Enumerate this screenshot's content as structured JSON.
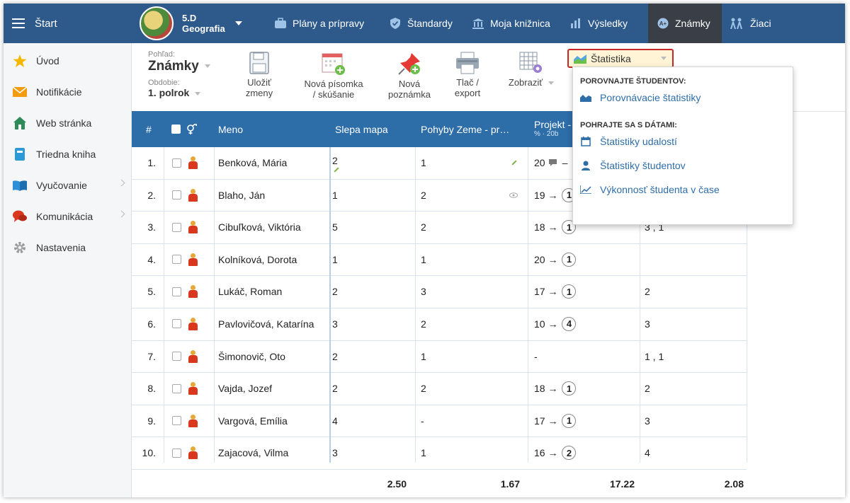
{
  "topbar": {
    "start_label": "Štart",
    "class_name": "5.D",
    "subject": "Geografia",
    "nav": [
      {
        "label": "Plány a prípravy",
        "icon": "briefcase-icon"
      },
      {
        "label": "Štandardy",
        "icon": "shield-check-icon"
      },
      {
        "label": "Moja knižnica",
        "icon": "library-icon"
      },
      {
        "label": "Výsledky",
        "icon": "bar-chart-icon"
      },
      {
        "label": "Známky",
        "icon": "grade-badge-icon"
      },
      {
        "label": "Žiaci",
        "icon": "students-icon"
      }
    ]
  },
  "sidebar": {
    "items": [
      {
        "label": "Úvod",
        "icon": "star-icon"
      },
      {
        "label": "Notifikácie",
        "icon": "envelope-icon"
      },
      {
        "label": "Web stránka",
        "icon": "home-icon"
      },
      {
        "label": "Triedna kniha",
        "icon": "book-icon"
      },
      {
        "label": "Vyučovanie",
        "icon": "open-book-icon"
      },
      {
        "label": "Komunikácia",
        "icon": "chat-icon"
      },
      {
        "label": "Nastavenia",
        "icon": "gear-icon"
      }
    ]
  },
  "toolbar": {
    "view_label": "Pohľad:",
    "view_value": "Známky",
    "period_label": "Obdobie:",
    "period_value": "1. polrok",
    "save_l1": "Uložiť",
    "save_l2": "zmeny",
    "new_test_l1": "Nová písomka",
    "new_test_l2": "/ skúšanie",
    "new_note_l1": "Nová",
    "new_note_l2": "poznámka",
    "print_l1": "Tlač /",
    "print_l2": "export",
    "show_label": "Zobraziť",
    "stats_label": "Štatistika"
  },
  "dropdown": {
    "compare_heading": "POROVNAJTE ŠTUDENTOV:",
    "compare_item": "Porovnávacie štatistiky",
    "play_heading": "POHRAJTE SA S DÁTAMI:",
    "event_stats": "Štatistiky udalostí",
    "student_stats": "Štatistiky študentov",
    "performance": "Výkonnosť študenta v čase"
  },
  "table": {
    "headers": {
      "num": "#",
      "gender_icon": "gender-icon",
      "name": "Meno",
      "col1": "Slepa mapa",
      "col2": "Pohyby Zeme - pr…",
      "col3": "Projekt -",
      "col3_sub": "% · 20b"
    },
    "rows": [
      {
        "num": "1.",
        "name": "Benková, Mária",
        "c1": "2",
        "c2": "1",
        "c3": "20",
        "c3grade": "",
        "c4": ""
      },
      {
        "num": "2.",
        "name": "Blaho, Ján",
        "c1": "1",
        "c2": "2",
        "c3": "19 →",
        "c3grade": "1",
        "c4": ""
      },
      {
        "num": "3.",
        "name": "Cibuľková, Viktória",
        "c1": "5",
        "c2": "2",
        "c3": "18 →",
        "c3grade": "1",
        "c4": "3 , 1"
      },
      {
        "num": "4.",
        "name": "Kolníková, Dorota",
        "c1": "1",
        "c2": "1",
        "c3": "20 →",
        "c3grade": "1",
        "c4": ""
      },
      {
        "num": "5.",
        "name": "Lukáč, Roman",
        "c1": "2",
        "c2": "3",
        "c3": "17 →",
        "c3grade": "1",
        "c4": "2"
      },
      {
        "num": "6.",
        "name": "Pavlovičová, Katarína",
        "c1": "3",
        "c2": "2",
        "c3": "10 →",
        "c3grade": "4",
        "c4": "3"
      },
      {
        "num": "7.",
        "name": "Šimonovič, Oto",
        "c1": "2",
        "c2": "1",
        "c3": "-",
        "c3grade": "",
        "c4": "1 , 1"
      },
      {
        "num": "8.",
        "name": "Vajda, Jozef",
        "c1": "2",
        "c2": "2",
        "c3": "18 →",
        "c3grade": "1",
        "c4": "2"
      },
      {
        "num": "9.",
        "name": "Vargová, Emília",
        "c1": "4",
        "c2": "-",
        "c3": "17 →",
        "c3grade": "1",
        "c4": "3"
      },
      {
        "num": "10.",
        "name": "Zajacová, Vilma",
        "c1": "3",
        "c2": "1",
        "c3": "16 →",
        "c3grade": "2",
        "c4": "4"
      }
    ],
    "averages": {
      "c1": "2.50",
      "c2": "1.67",
      "c3": "17.22",
      "c4": "2.08"
    }
  },
  "colors": {
    "topbar": "#2d5a8b",
    "table_header": "#2d6da8",
    "active_tab": "#3a3f47",
    "highlight_border": "#c62828"
  }
}
